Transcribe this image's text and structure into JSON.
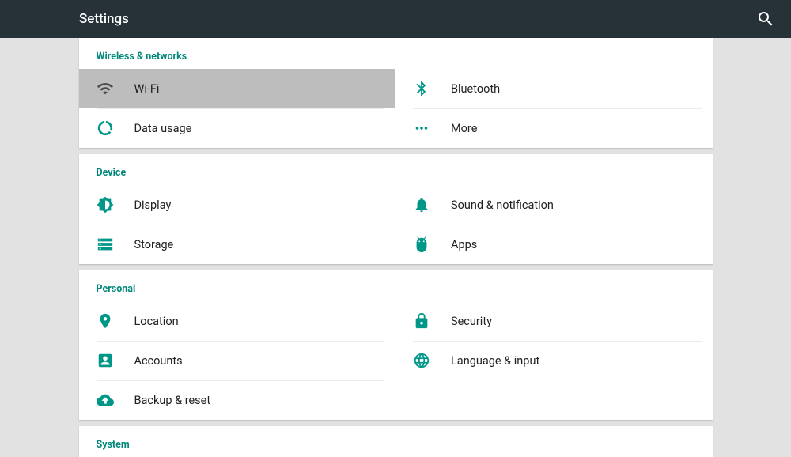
{
  "appbar": {
    "title": "Settings"
  },
  "sections": {
    "wireless": {
      "header": "Wireless & networks",
      "items": {
        "wifi": "Wi-Fi",
        "bluetooth": "Bluetooth",
        "data_usage": "Data usage",
        "more": "More"
      }
    },
    "device": {
      "header": "Device",
      "items": {
        "display": "Display",
        "sound": "Sound & notification",
        "storage": "Storage",
        "apps": "Apps"
      }
    },
    "personal": {
      "header": "Personal",
      "items": {
        "location": "Location",
        "security": "Security",
        "accounts": "Accounts",
        "language": "Language & input",
        "backup": "Backup & reset"
      }
    },
    "system": {
      "header": "System"
    }
  }
}
